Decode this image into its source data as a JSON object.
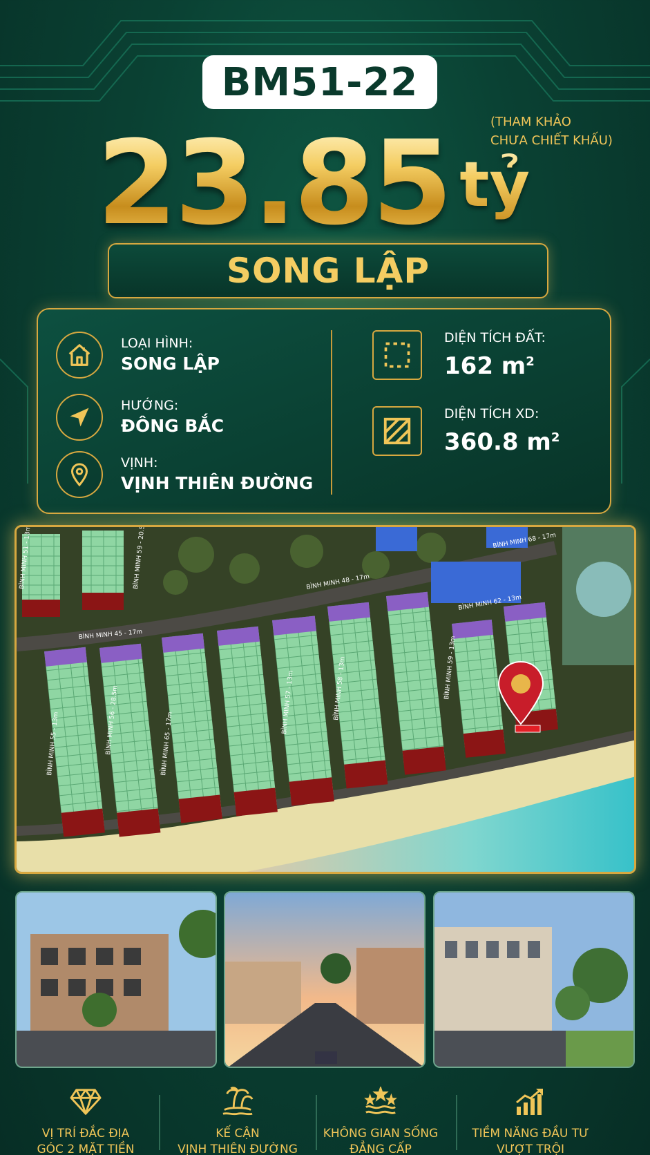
{
  "listing": {
    "code": "BM51-22",
    "price_number": "23.85",
    "price_unit": "tỷ",
    "note_line1": "(THAM KHẢO",
    "note_line2": "CHƯA CHIẾT KHẤU)",
    "type_banner": "SONG LẬP"
  },
  "info": {
    "type_label": "LOẠI HÌNH:",
    "type_value": "SONG LẬP",
    "direction_label": "HƯỚNG:",
    "direction_value": "ĐÔNG BẮC",
    "bay_label": "VỊNH:",
    "bay_value": "VỊNH THIÊN ĐƯỜNG",
    "land_area_label": "DIỆN TÍCH ĐẤT:",
    "land_area_value": "162 m",
    "build_area_label": "DIỆN TÍCH XD:",
    "build_area_value": "360.8 m",
    "area_sup": "2"
  },
  "map": {
    "streets": [
      "BÌNH MINH 45 - 17m",
      "BÌNH MINH 48 - 17m",
      "BÌNH MINH 68 - 17m",
      "BÌNH MINH 62 - 13m",
      "BÌNH MINH 55 - 13m",
      "BÌNH MINH 56 - 28.5m",
      "BÌNH MINH 57 - 13m",
      "BÌNH MINH 58 - 13m",
      "BÌNH MINH 59 - 13m",
      "BÌNH MINH 65 - 17m",
      "BÌNH MINH 51 - 13m",
      "BÌNH MINH 59 - 20.5m"
    ]
  },
  "features": [
    {
      "line1": "VỊ TRÍ ĐẮC ĐỊA",
      "line2": "GÓC 2 MẶT TIỀN",
      "icon": "diamond-icon"
    },
    {
      "line1": "KẾ CẬN",
      "line2": "VỊNH THIÊN ĐƯỜNG",
      "icon": "palm-island-icon"
    },
    {
      "line1": "KHÔNG GIAN SỐNG",
      "line2": "ĐẲNG CẤP",
      "icon": "stars-waves-icon"
    },
    {
      "line1": "TIỀM NĂNG ĐẦU TƯ",
      "line2": "VƯỢT TRỘI",
      "icon": "growth-chart-icon"
    }
  ],
  "colors": {
    "background": "#0a4133",
    "gold": "#f0c558",
    "gold_border": "#d7a840"
  }
}
